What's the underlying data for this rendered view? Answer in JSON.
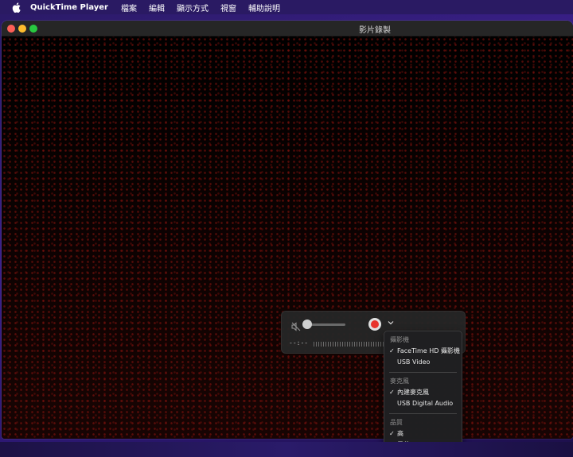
{
  "menubar": {
    "app_name": "QuickTime Player",
    "items": [
      "檔案",
      "編輯",
      "顯示方式",
      "視窗",
      "輔助說明"
    ]
  },
  "window": {
    "title": "影片錄製"
  },
  "controls": {
    "time": "--:--",
    "volume": 0,
    "muted": true
  },
  "dropdown": {
    "sections": [
      {
        "header": "攝影機",
        "items": [
          {
            "label": "FaceTime HD 攝影機",
            "checked": true
          },
          {
            "label": "USB Video",
            "checked": false
          }
        ]
      },
      {
        "header": "麥克風",
        "items": [
          {
            "label": "內建麥克風",
            "checked": true
          },
          {
            "label": "USB Digital Audio",
            "checked": false
          }
        ]
      },
      {
        "header": "品質",
        "items": [
          {
            "label": "高",
            "checked": true
          },
          {
            "label": "最佳",
            "checked": false
          }
        ]
      }
    ],
    "check_glyph": "✓"
  },
  "colors": {
    "record": "#e8332b",
    "close": "#fe5f57",
    "minimize": "#febc2e",
    "maximize": "#28c840"
  }
}
